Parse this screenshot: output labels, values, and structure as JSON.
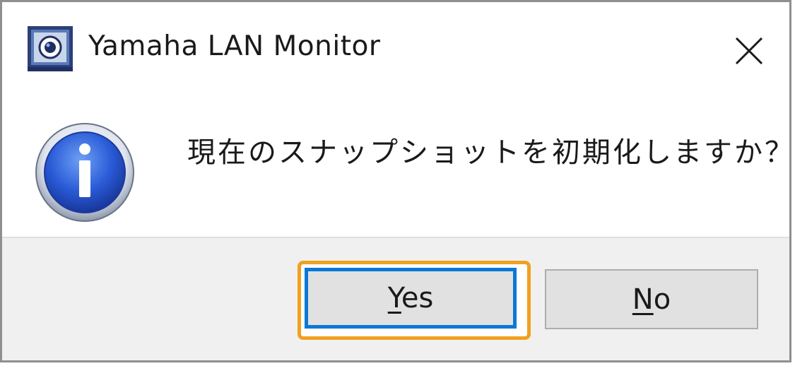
{
  "window": {
    "title": "Yamaha LAN Monitor",
    "app_icon": "yamaha-lan-monitor-icon",
    "close_icon": "close-icon"
  },
  "message": {
    "icon": "information-icon",
    "text": "現在のスナップショットを初期化しますか？"
  },
  "buttons": {
    "yes": {
      "mnemonic": "Y",
      "rest": "es",
      "label": "Yes",
      "state": "focused"
    },
    "no": {
      "mnemonic": "N",
      "rest": "o",
      "label": "No"
    }
  },
  "colors": {
    "focus_highlight": "#f0a020",
    "default_button_border": "#0a78d7",
    "footer_background": "#f0f0f0"
  }
}
